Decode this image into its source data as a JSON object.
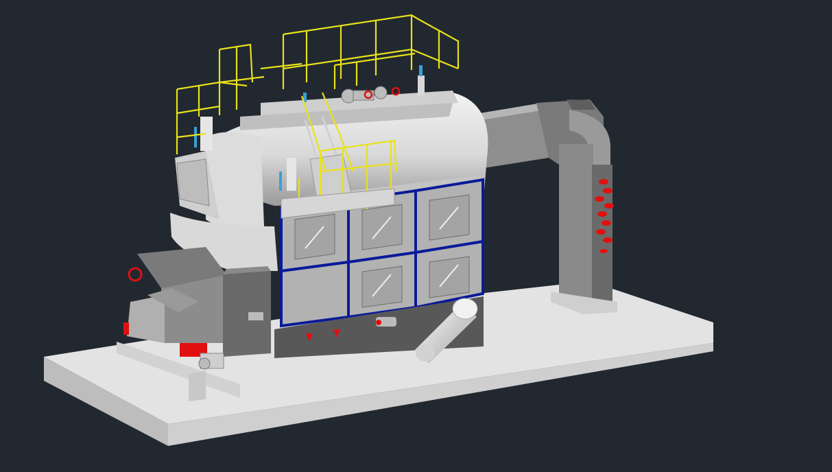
{
  "viewport": {
    "background": "#212830",
    "colors": {
      "railing": "#e8e21a",
      "panel_frame": "#0a1a9a",
      "valve": "#e01010",
      "steel_light": "#e6e6e6",
      "steel_mid": "#b9b9b9",
      "steel_dark": "#6e6e6e",
      "gauge": "#3aa0d8"
    },
    "model": {
      "description_icon": "boiler-3d-model-icon",
      "parts": [
        "base-slab",
        "coal-hopper",
        "grate-chain",
        "boiler-drum",
        "front-access-panels",
        "flue-duct",
        "economizer-stack",
        "top-platform-railing",
        "ladder",
        "valves",
        "blower-pipe"
      ]
    }
  }
}
